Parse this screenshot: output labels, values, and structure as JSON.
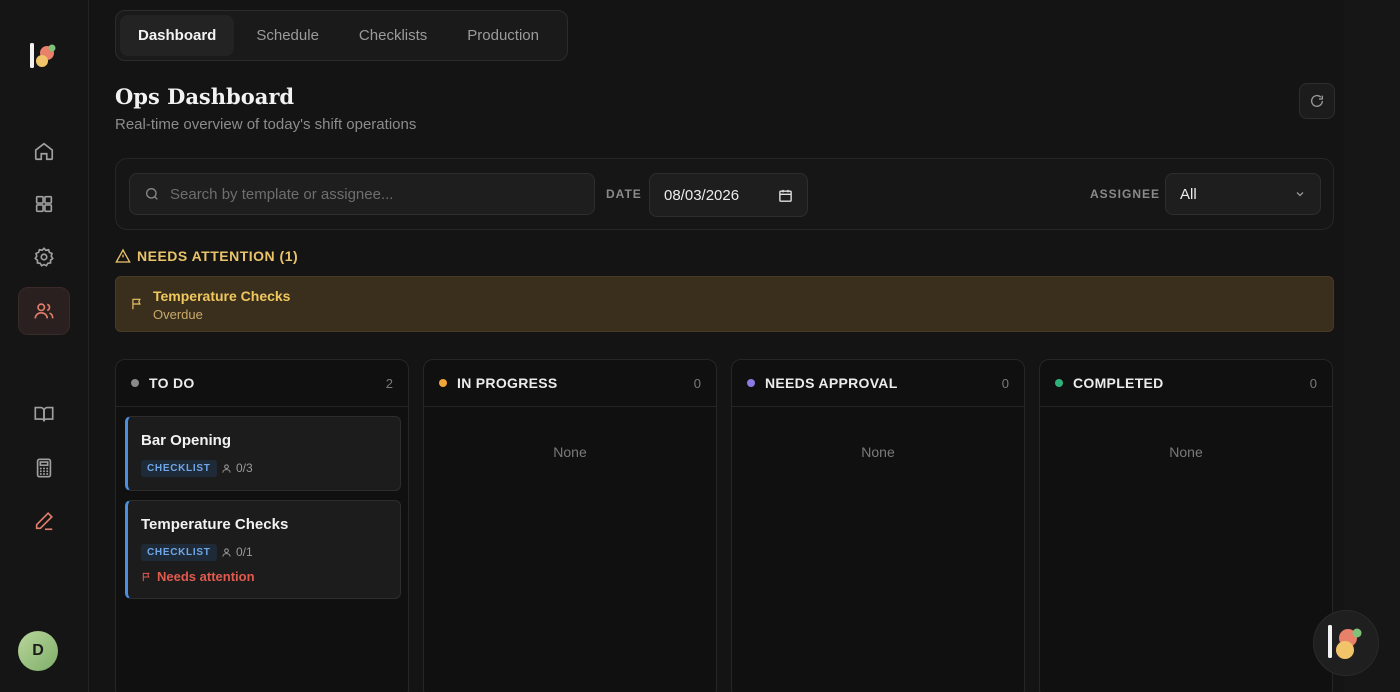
{
  "nav": {
    "tabs": [
      {
        "label": "Dashboard",
        "active": true
      },
      {
        "label": "Schedule",
        "active": false
      },
      {
        "label": "Checklists",
        "active": false
      },
      {
        "label": "Production",
        "active": false
      }
    ]
  },
  "sidebar": {
    "items": [
      {
        "name": "home-icon"
      },
      {
        "name": "grid-icon"
      },
      {
        "name": "gear-icon"
      },
      {
        "name": "users-icon",
        "active": true
      },
      {
        "name": "book-icon"
      },
      {
        "name": "calculator-icon"
      },
      {
        "name": "pen-icon"
      }
    ],
    "avatar_initial": "D"
  },
  "header": {
    "title": "Ops Dashboard",
    "subtitle": "Real-time overview of today's shift operations"
  },
  "filters": {
    "search_placeholder": "Search by template or assignee...",
    "date_label": "DATE",
    "date_value": "08/03/2026",
    "assignee_label": "ASSIGNEE",
    "assignee_value": "All"
  },
  "attention": {
    "heading": "NEEDS ATTENTION (1)",
    "item_title": "Temperature Checks",
    "item_status": "Overdue"
  },
  "columns": [
    {
      "title": "TO DO",
      "count": "2",
      "color": "#8a8a8a"
    },
    {
      "title": "IN PROGRESS",
      "count": "0",
      "color": "#f0a43a",
      "empty": "None"
    },
    {
      "title": "NEEDS APPROVAL",
      "count": "0",
      "color": "#8b7be0",
      "empty": "None"
    },
    {
      "title": "COMPLETED",
      "count": "0",
      "color": "#2fb27a",
      "empty": "None"
    }
  ],
  "cards": [
    {
      "title": "Bar Opening",
      "badge": "CHECKLIST",
      "progress": "0/3"
    },
    {
      "title": "Temperature Checks",
      "badge": "CHECKLIST",
      "progress": "0/1",
      "alert": "Needs attention"
    }
  ],
  "colors": {
    "accent_blue": "#4a8fe0",
    "warning": "#e9c46a",
    "danger": "#e05a4f"
  }
}
